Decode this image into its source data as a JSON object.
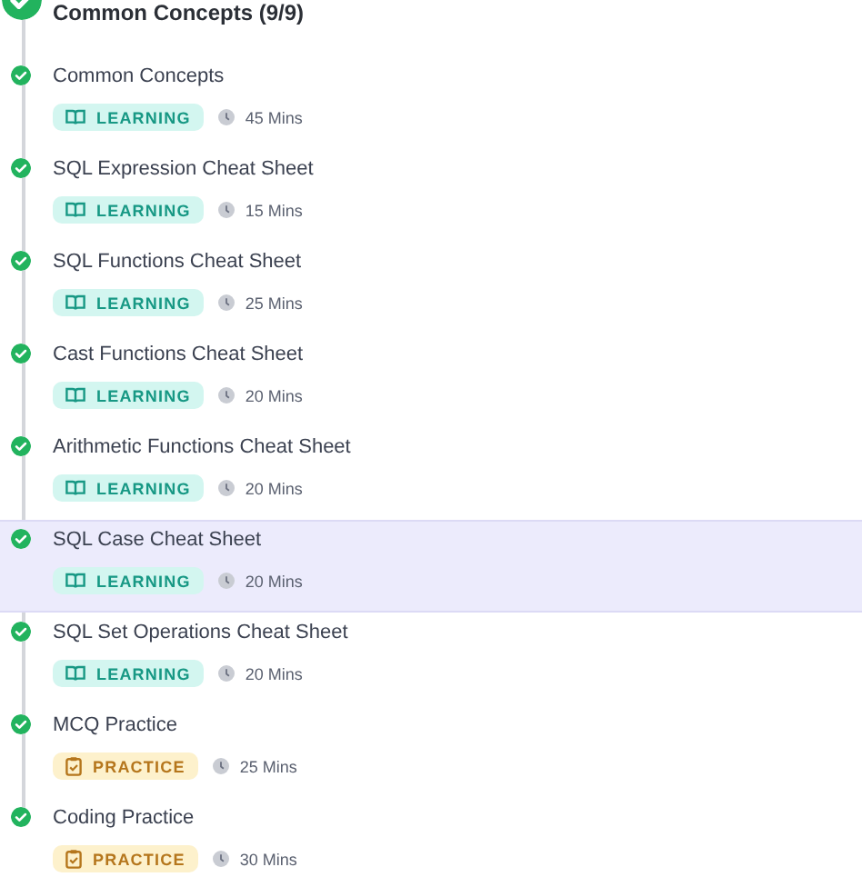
{
  "section": {
    "title": "Common Concepts (9/9)",
    "completed": true
  },
  "items": [
    {
      "title": "Common Concepts",
      "kind": "learning",
      "badge": "LEARNING",
      "duration": "45 Mins",
      "completed": true,
      "selected": false
    },
    {
      "title": "SQL Expression Cheat Sheet",
      "kind": "learning",
      "badge": "LEARNING",
      "duration": "15 Mins",
      "completed": true,
      "selected": false
    },
    {
      "title": "SQL Functions Cheat Sheet",
      "kind": "learning",
      "badge": "LEARNING",
      "duration": "25 Mins",
      "completed": true,
      "selected": false
    },
    {
      "title": "Cast Functions Cheat Sheet",
      "kind": "learning",
      "badge": "LEARNING",
      "duration": "20 Mins",
      "completed": true,
      "selected": false
    },
    {
      "title": "Arithmetic Functions Cheat Sheet",
      "kind": "learning",
      "badge": "LEARNING",
      "duration": "20 Mins",
      "completed": true,
      "selected": false
    },
    {
      "title": "SQL Case Cheat Sheet",
      "kind": "learning",
      "badge": "LEARNING",
      "duration": "20 Mins",
      "completed": true,
      "selected": true
    },
    {
      "title": "SQL Set Operations Cheat Sheet",
      "kind": "learning",
      "badge": "LEARNING",
      "duration": "20 Mins",
      "completed": true,
      "selected": false
    },
    {
      "title": "MCQ Practice",
      "kind": "practice",
      "badge": "PRACTICE",
      "duration": "25 Mins",
      "completed": true,
      "selected": false
    },
    {
      "title": "Coding Practice",
      "kind": "practice",
      "badge": "PRACTICE",
      "duration": "30 Mins",
      "completed": true,
      "selected": false
    }
  ]
}
